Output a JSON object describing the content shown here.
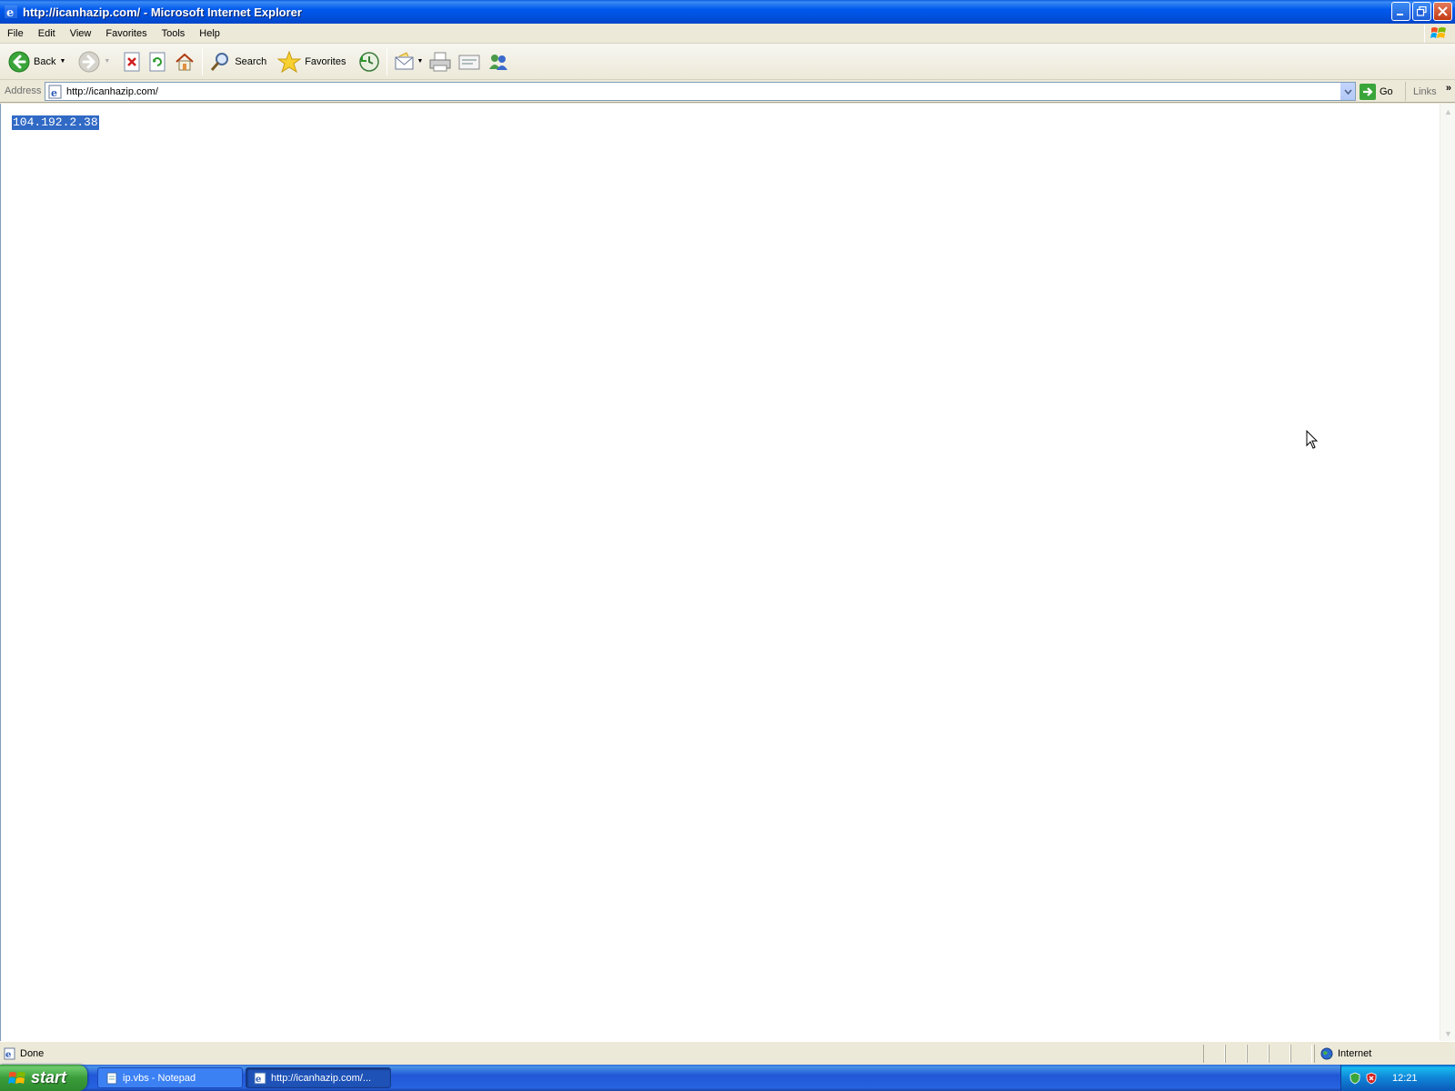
{
  "window": {
    "title": "http://icanhazip.com/ - Microsoft Internet Explorer"
  },
  "menu": [
    "File",
    "Edit",
    "View",
    "Favorites",
    "Tools",
    "Help"
  ],
  "toolbar": {
    "back_label": "Back",
    "search_label": "Search",
    "favorites_label": "Favorites"
  },
  "address": {
    "label": "Address",
    "value": "http://icanhazip.com/",
    "go_label": "Go",
    "links_label": "Links"
  },
  "page": {
    "ip_text": "104.192.2.38"
  },
  "status": {
    "text": "Done",
    "zone": "Internet"
  },
  "taskbar": {
    "start_label": "start",
    "tasks": [
      {
        "label": "ip.vbs - Notepad"
      },
      {
        "label": "http://icanhazip.com/..."
      }
    ],
    "clock": "12:21"
  }
}
